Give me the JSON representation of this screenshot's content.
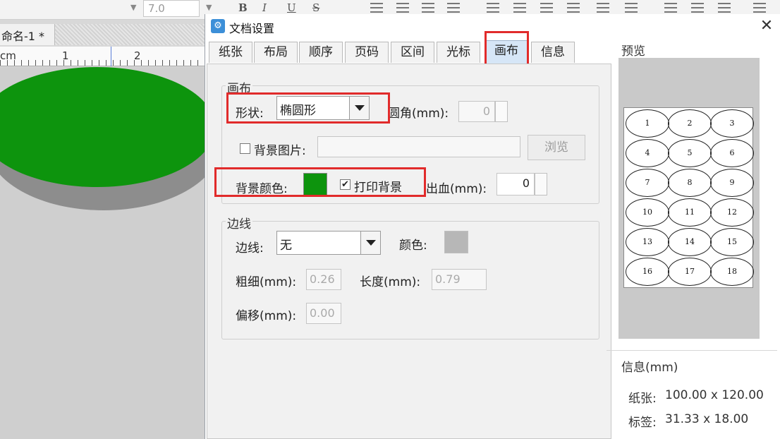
{
  "app": {
    "font_size_value": "7.0",
    "format_buttons": [
      "B",
      "I",
      "U",
      "S"
    ],
    "doc_tab": "命名-1 *",
    "ruler_unit": "cm",
    "ruler_labels": [
      "1",
      "2"
    ],
    "canvas_shape_color": "#0d940d"
  },
  "dialog": {
    "title": "文档设置",
    "close_label": "✕",
    "tabs": [
      {
        "label": "纸张",
        "active": false
      },
      {
        "label": "布局",
        "active": false
      },
      {
        "label": "顺序",
        "active": false
      },
      {
        "label": "页码",
        "active": false
      },
      {
        "label": "区间",
        "active": false
      },
      {
        "label": "光标",
        "active": false
      },
      {
        "label": "画布",
        "active": true
      },
      {
        "label": "信息",
        "active": false
      }
    ],
    "canvas_group": {
      "title": "画布",
      "shape_label": "形状:",
      "shape_value": "椭圆形",
      "corner_label": "圆角(mm):",
      "corner_value": "0",
      "bg_image_label": "背景图片:",
      "bg_image_checked": false,
      "bg_image_path": "",
      "browse_label": "浏览",
      "bg_color_label": "背景颜色:",
      "bg_color": "#0d940d",
      "print_bg_label": "打印背景",
      "print_bg_checked": true,
      "bleed_label": "出血(mm):",
      "bleed_value": "0"
    },
    "border_group": {
      "title": "边线",
      "border_label": "边线:",
      "border_value": "无",
      "color_label": "颜色:",
      "color": "#b7b7b7",
      "thickness_label": "粗细(mm):",
      "thickness_value": "0.26",
      "length_label": "长度(mm):",
      "length_value": "0.79",
      "offset_label": "偏移(mm):",
      "offset_value": "0.00"
    },
    "preview": {
      "title": "预览",
      "labels": [
        "1",
        "2",
        "3",
        "4",
        "5",
        "6",
        "7",
        "8",
        "9",
        "10",
        "11",
        "12",
        "13",
        "14",
        "15",
        "16",
        "17",
        "18"
      ]
    },
    "info": {
      "title": "信息(mm)",
      "paper_label": "纸张:",
      "paper_value": "100.00 x 120.00",
      "label_label": "标签:",
      "label_value": "31.33 x 18.00"
    }
  }
}
